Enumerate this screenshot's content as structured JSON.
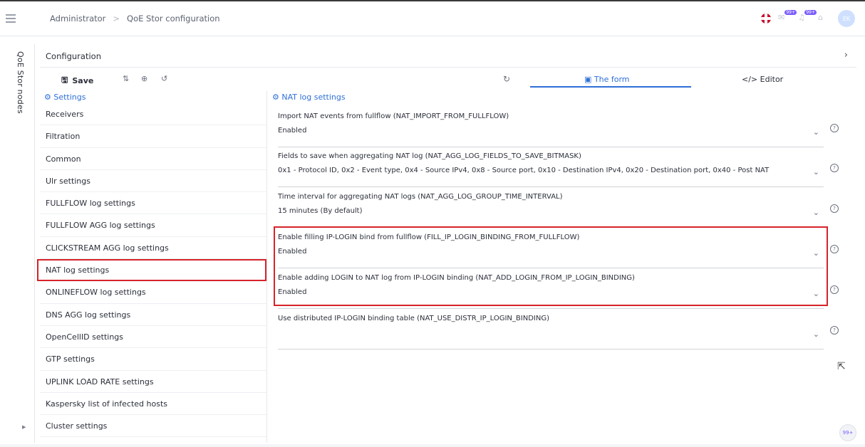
{
  "breadcrumb": {
    "root": "Administrator",
    "sep": ">",
    "current": "QoE Stor configuration"
  },
  "topbar": {
    "badge1": "99+",
    "badge2": "99+",
    "avatar": "EK",
    "icons": [
      "menu-icon",
      "uk-flag-icon",
      "mail-icon",
      "bell-icon",
      "home-icon"
    ]
  },
  "side_tab": {
    "label": "QoE Stor nodes"
  },
  "config": {
    "title": "Configuration",
    "chevron": "›"
  },
  "toolbar": {
    "save_label": "Save",
    "save_icon": "🖫",
    "icon_split": "⇅",
    "icon_upload": "⊕",
    "icon_history": "↺"
  },
  "tabs": {
    "refresh": "↻",
    "form_label": "The form",
    "editor_label": "Editor"
  },
  "settings": {
    "header": "Settings",
    "items": [
      "Receivers",
      "Filtration",
      "Common",
      "Ulr settings",
      "FULLFLOW log settings",
      "FULLFLOW AGG log settings",
      "CLICKSTREAM AGG log settings",
      "NAT log settings",
      "ONLINEFLOW log settings",
      "DNS AGG log settings",
      "OpenCellID settings",
      "GTP settings",
      "UPLINK LOAD RATE settings",
      "Kaspersky list of infected hosts",
      "Cluster settings"
    ],
    "selected_index": 7
  },
  "section": {
    "title": "NAT log settings"
  },
  "fields": [
    {
      "label": "Import NAT events from fullflow (NAT_IMPORT_FROM_FULLFLOW)",
      "value": "Enabled"
    },
    {
      "label": "Fields to save when aggregating NAT log (NAT_AGG_LOG_FIELDS_TO_SAVE_BITMASK)",
      "value": "0x1 - Protocol ID, 0x2 - Event type, 0x4 - Source IPv4, 0x8 - Source port, 0x10 - Destination IPv4, 0x20 - Destination port, 0x40 - Post NAT"
    },
    {
      "label": "Time interval for aggregating NAT logs (NAT_AGG_LOG_GROUP_TIME_INTERVAL)",
      "value": "15 minutes (By default)"
    },
    {
      "label": "Enable filling IP-LOGIN bind from fullflow (FILL_IP_LOGIN_BINDING_FROM_FULLFLOW)",
      "value": "Enabled"
    },
    {
      "label": "Enable adding LOGIN to NAT log from IP-LOGIN binding (NAT_ADD_LOGIN_FROM_IP_LOGIN_BINDING)",
      "value": "Enabled"
    },
    {
      "label": "Use distributed IP-LOGIN binding table (NAT_USE_DISTR_IP_LOGIN_BINDING)",
      "value": ""
    }
  ],
  "colors": {
    "accent": "#2f6fd8",
    "highlight": "#d6232a"
  }
}
